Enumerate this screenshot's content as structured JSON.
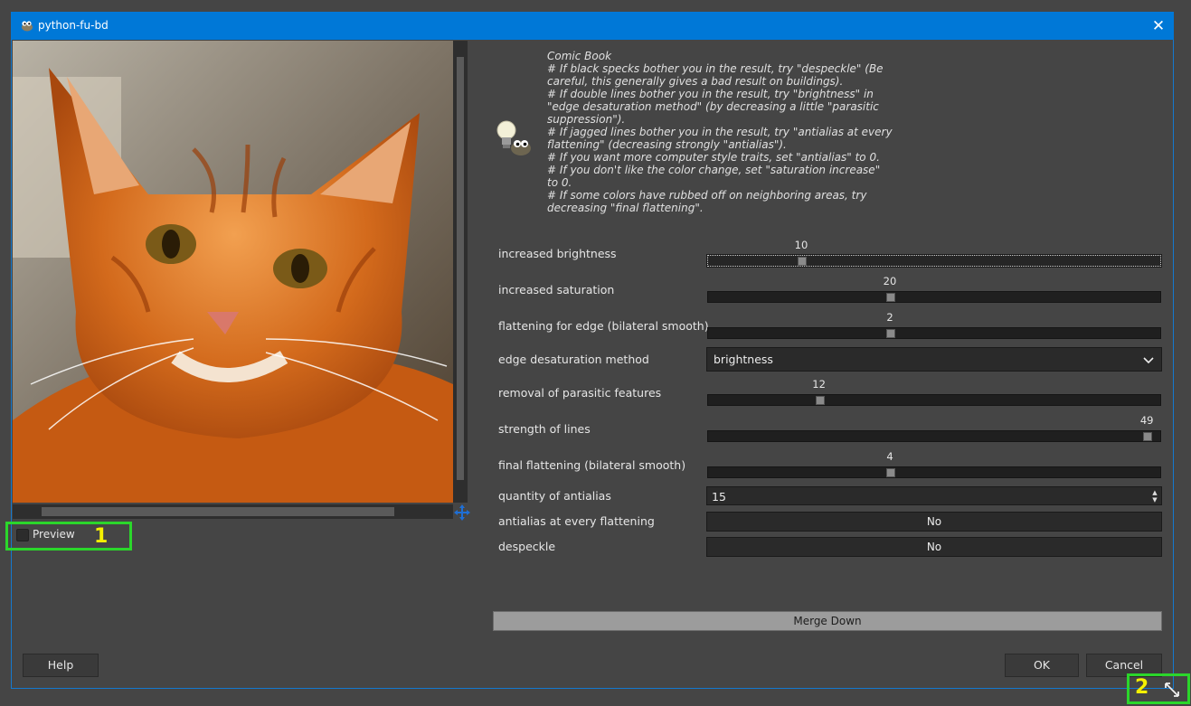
{
  "window": {
    "title": "python-fu-bd",
    "close_label": "✕"
  },
  "preview": {
    "label": "Preview",
    "checked": false,
    "image_icon": "cat-photo"
  },
  "markers": {
    "one": "1",
    "two": "2"
  },
  "description": {
    "icon": "lightbulb-wilber-icon",
    "lines": [
      "Comic Book",
      "# If black specks bother you in the result, try \"despeckle\" (Be",
      "careful, this generally gives a bad result on buildings).",
      "# If double lines bother you in the result, try \"brightness\" in",
      "\"edge desaturation method\" (by decreasing a little \"parasitic",
      "suppression\").",
      "# If jagged lines bother you in the result, try \"antialias at every",
      "flattening\" (decreasing strongly \"antialias\").",
      "# If you want more computer style traits, set \"antialias\" to 0.",
      "# If you don't like the color change, set \"saturation increase\"",
      "to 0.",
      "# If some colors have rubbed off on neighboring areas, try",
      "decreasing \"final flattening\"."
    ]
  },
  "params": {
    "brightness": {
      "label": "increased brightness",
      "value": "10",
      "fraction": 0.2
    },
    "saturation": {
      "label": "increased saturation",
      "value": "20",
      "fraction": 0.4
    },
    "edge_flattening": {
      "label": "flattening for edge (bilateral smooth)",
      "value": "2",
      "fraction": 0.4
    },
    "edge_method": {
      "label": "edge desaturation method",
      "value": "brightness"
    },
    "parasitic": {
      "label": "removal of parasitic features",
      "value": "12",
      "fraction": 0.24
    },
    "lines": {
      "label": "strength of lines",
      "value": "49",
      "fraction": 0.98
    },
    "final_flattening": {
      "label": "final flattening (bilateral smooth)",
      "value": "4",
      "fraction": 0.4
    },
    "antialias": {
      "label": "quantity of antialias",
      "value": "15"
    },
    "antialias_every": {
      "label": "antialias at every flattening",
      "value": "No"
    },
    "despeckle": {
      "label": "despeckle",
      "value": "No"
    }
  },
  "buttons": {
    "merge_down": "Merge Down",
    "help": "Help",
    "ok": "OK",
    "cancel": "Cancel"
  }
}
